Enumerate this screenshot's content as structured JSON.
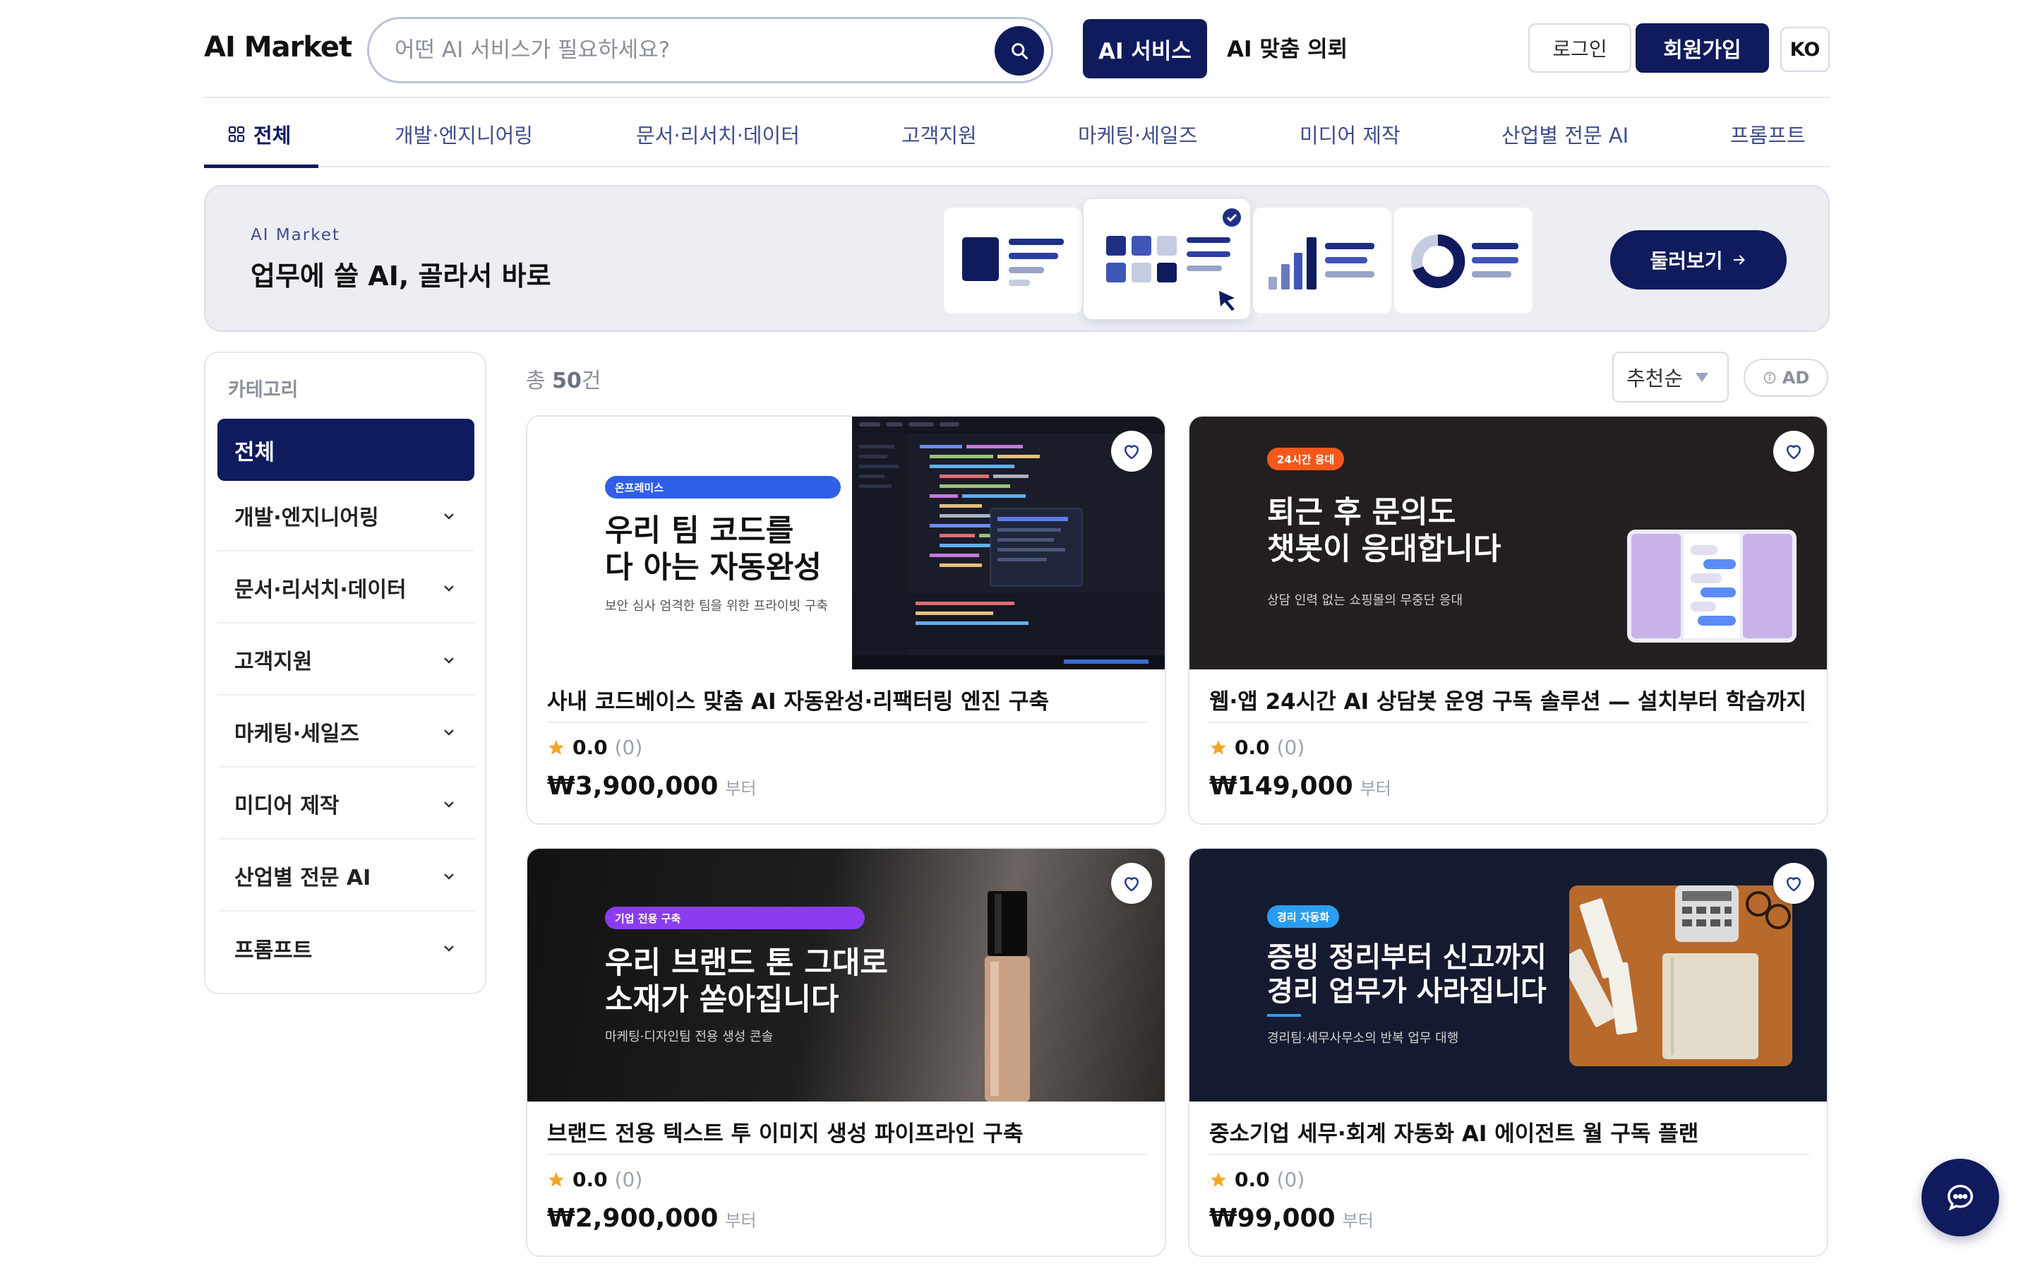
{
  "header": {
    "logo": "AI Market",
    "search_placeholder": "어떤 AI 서비스가 필요하세요?",
    "nav_ai_services": "AI 서비스",
    "nav_custom_request": "AI 맞춤 의뢰",
    "login": "로그인",
    "signup": "회원가입",
    "language": "KO"
  },
  "tabs": [
    {
      "label": "전체",
      "active": true
    },
    {
      "label": "개발·엔지니어링"
    },
    {
      "label": "문서·리서치·데이터"
    },
    {
      "label": "고객지원"
    },
    {
      "label": "마케팅·세일즈"
    },
    {
      "label": "미디어 제작"
    },
    {
      "label": "산업별 전문 AI"
    },
    {
      "label": "프롬프트"
    }
  ],
  "banner": {
    "eyebrow": "AI Market",
    "title": "업무에 쓸 AI, 골라서 바로",
    "button": "둘러보기"
  },
  "sidebar": {
    "heading": "카테고리",
    "items": [
      {
        "label": "전체",
        "selected": true
      },
      {
        "label": "개발·엔지니어링"
      },
      {
        "label": "문서·리서치·데이터"
      },
      {
        "label": "고객지원"
      },
      {
        "label": "마케팅·세일즈"
      },
      {
        "label": "미디어 제작"
      },
      {
        "label": "산업별 전문 AI"
      },
      {
        "label": "프롬프트"
      }
    ]
  },
  "results": {
    "count_prefix": "총",
    "count_value": "50",
    "count_suffix": "건",
    "sort": "추천순",
    "ad_label": "AD"
  },
  "products": [
    {
      "badge": "온프레미스",
      "thumb_title": "우리 팀 코드를\n다 아는 자동완성",
      "thumb_subtitle": "보안 심사 엄격한 팀을 위한 프라이빗 구축",
      "title": "사내 코드베이스 맞춤 AI 자동완성·리팩터링 엔진 구축",
      "rating": "0.0",
      "reviews": "(0)",
      "price": "₩3,900,000",
      "price_unit": "부터"
    },
    {
      "badge": "24시간 응대",
      "thumb_title": "퇴근 후 문의도\n챗봇이 응대합니다",
      "thumb_subtitle": "상담 인력 없는 쇼핑몰의 무중단 응대",
      "title": "웹·앱 24시간 AI 상담봇 운영 구독 솔루션 — 설치부터 학습까지",
      "rating": "0.0",
      "reviews": "(0)",
      "price": "₩149,000",
      "price_unit": "부터"
    },
    {
      "badge": "기업 전용 구축",
      "thumb_title": "우리 브랜드 톤 그대로\n소재가 쏟아집니다",
      "thumb_subtitle": "마케팅·디자인팀 전용 생성 콘솔",
      "title": "브랜드 전용 텍스트 투 이미지 생성 파이프라인 구축",
      "rating": "0.0",
      "reviews": "(0)",
      "price": "₩2,900,000",
      "price_unit": "부터"
    },
    {
      "badge": "경리 자동화",
      "thumb_title": "증빙 정리부터 신고까지\n경리 업무가 사라집니다",
      "thumb_subtitle": "경리팀·세무사무소의 반복 업무 대행",
      "title": "중소기업 세무·회계 자동화 AI 에이전트 월 구독 플랜",
      "rating": "0.0",
      "reviews": "(0)",
      "price": "₩99,000",
      "price_unit": "부터"
    }
  ],
  "colors": {
    "primary": "#0f1b5c",
    "accent_blue": "#2f5fe8",
    "accent_orange": "#f4581c",
    "accent_purple": "#8b3cf0",
    "accent_sky": "#2a9df0",
    "star": "#f5a524"
  }
}
